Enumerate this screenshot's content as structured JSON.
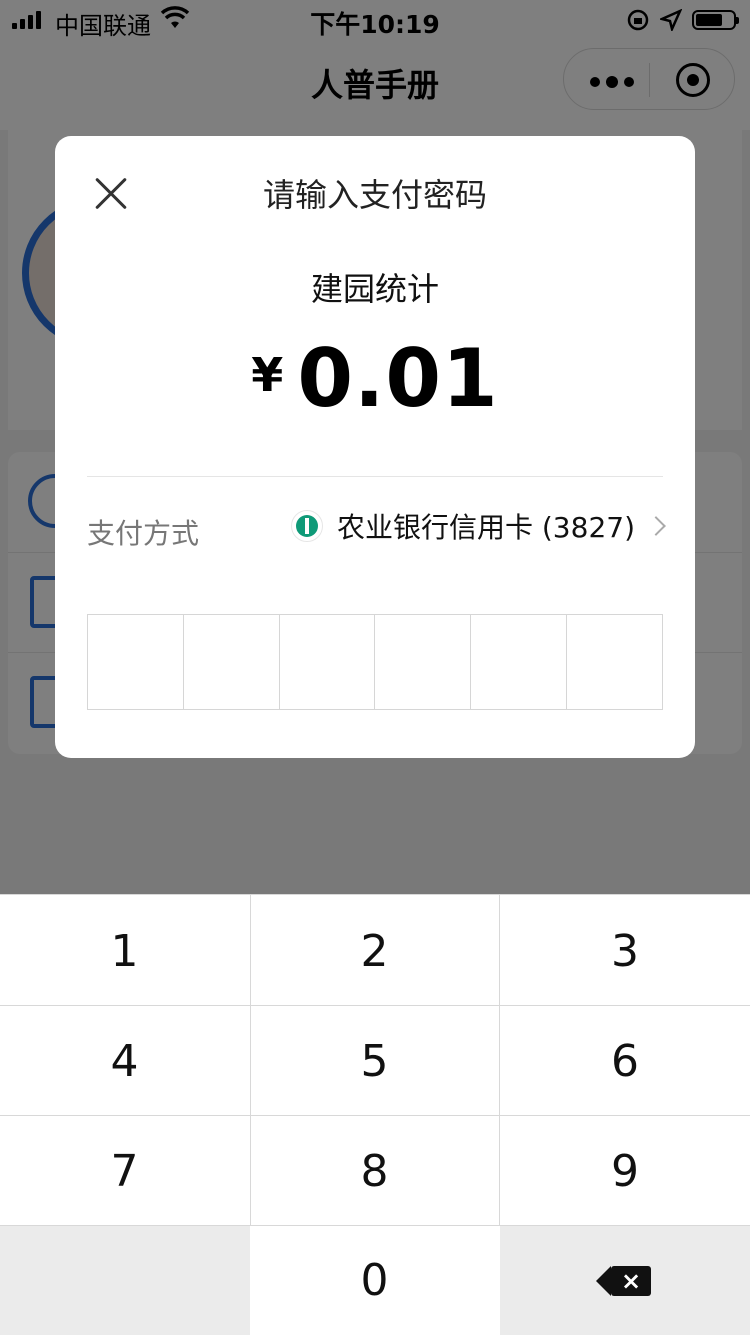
{
  "status_bar": {
    "carrier": "中国联通",
    "time": "下午10:19"
  },
  "navbar": {
    "title": "人普手册",
    "more_icon": "more-dots-icon",
    "close_icon": "target-circle-icon"
  },
  "dialog": {
    "title": "请输入支付密码",
    "merchant": "建园统计",
    "currency_symbol": "¥",
    "amount": "0.01",
    "payment_method_label": "支付方式",
    "payment_method_value": "农业银行信用卡 (3827)",
    "bank_icon": "abc-bank-logo-icon",
    "password_length": 6,
    "entered_digits": 0
  },
  "keypad": {
    "keys": [
      "1",
      "2",
      "3",
      "4",
      "5",
      "6",
      "7",
      "8",
      "9",
      "",
      "0",
      "backspace"
    ],
    "labels": {
      "k1": "1",
      "k2": "2",
      "k3": "3",
      "k4": "4",
      "k5": "5",
      "k6": "6",
      "k7": "7",
      "k8": "8",
      "k9": "9",
      "k0": "0"
    }
  },
  "colors": {
    "accent_blue": "#2a6fd6",
    "bank_green": "#0f9a78",
    "overlay": "rgba(0,0,0,0.5)"
  }
}
